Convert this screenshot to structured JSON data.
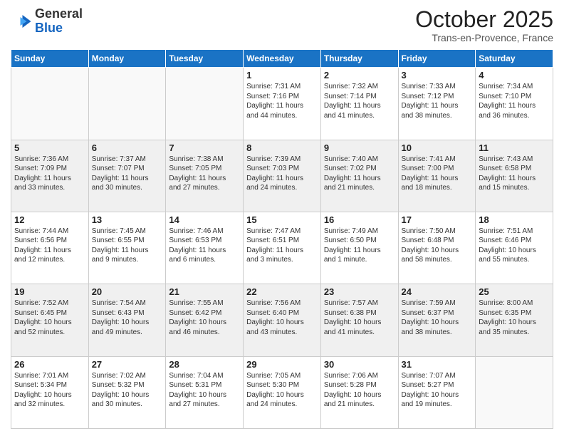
{
  "header": {
    "logo_line1": "General",
    "logo_line2": "Blue",
    "title": "October 2025",
    "subtitle": "Trans-en-Provence, France"
  },
  "days_of_week": [
    "Sunday",
    "Monday",
    "Tuesday",
    "Wednesday",
    "Thursday",
    "Friday",
    "Saturday"
  ],
  "weeks": [
    [
      {
        "day": "",
        "text": ""
      },
      {
        "day": "",
        "text": ""
      },
      {
        "day": "",
        "text": ""
      },
      {
        "day": "1",
        "text": "Sunrise: 7:31 AM\nSunset: 7:16 PM\nDaylight: 11 hours\nand 44 minutes."
      },
      {
        "day": "2",
        "text": "Sunrise: 7:32 AM\nSunset: 7:14 PM\nDaylight: 11 hours\nand 41 minutes."
      },
      {
        "day": "3",
        "text": "Sunrise: 7:33 AM\nSunset: 7:12 PM\nDaylight: 11 hours\nand 38 minutes."
      },
      {
        "day": "4",
        "text": "Sunrise: 7:34 AM\nSunset: 7:10 PM\nDaylight: 11 hours\nand 36 minutes."
      }
    ],
    [
      {
        "day": "5",
        "text": "Sunrise: 7:36 AM\nSunset: 7:09 PM\nDaylight: 11 hours\nand 33 minutes."
      },
      {
        "day": "6",
        "text": "Sunrise: 7:37 AM\nSunset: 7:07 PM\nDaylight: 11 hours\nand 30 minutes."
      },
      {
        "day": "7",
        "text": "Sunrise: 7:38 AM\nSunset: 7:05 PM\nDaylight: 11 hours\nand 27 minutes."
      },
      {
        "day": "8",
        "text": "Sunrise: 7:39 AM\nSunset: 7:03 PM\nDaylight: 11 hours\nand 24 minutes."
      },
      {
        "day": "9",
        "text": "Sunrise: 7:40 AM\nSunset: 7:02 PM\nDaylight: 11 hours\nand 21 minutes."
      },
      {
        "day": "10",
        "text": "Sunrise: 7:41 AM\nSunset: 7:00 PM\nDaylight: 11 hours\nand 18 minutes."
      },
      {
        "day": "11",
        "text": "Sunrise: 7:43 AM\nSunset: 6:58 PM\nDaylight: 11 hours\nand 15 minutes."
      }
    ],
    [
      {
        "day": "12",
        "text": "Sunrise: 7:44 AM\nSunset: 6:56 PM\nDaylight: 11 hours\nand 12 minutes."
      },
      {
        "day": "13",
        "text": "Sunrise: 7:45 AM\nSunset: 6:55 PM\nDaylight: 11 hours\nand 9 minutes."
      },
      {
        "day": "14",
        "text": "Sunrise: 7:46 AM\nSunset: 6:53 PM\nDaylight: 11 hours\nand 6 minutes."
      },
      {
        "day": "15",
        "text": "Sunrise: 7:47 AM\nSunset: 6:51 PM\nDaylight: 11 hours\nand 3 minutes."
      },
      {
        "day": "16",
        "text": "Sunrise: 7:49 AM\nSunset: 6:50 PM\nDaylight: 11 hours\nand 1 minute."
      },
      {
        "day": "17",
        "text": "Sunrise: 7:50 AM\nSunset: 6:48 PM\nDaylight: 10 hours\nand 58 minutes."
      },
      {
        "day": "18",
        "text": "Sunrise: 7:51 AM\nSunset: 6:46 PM\nDaylight: 10 hours\nand 55 minutes."
      }
    ],
    [
      {
        "day": "19",
        "text": "Sunrise: 7:52 AM\nSunset: 6:45 PM\nDaylight: 10 hours\nand 52 minutes."
      },
      {
        "day": "20",
        "text": "Sunrise: 7:54 AM\nSunset: 6:43 PM\nDaylight: 10 hours\nand 49 minutes."
      },
      {
        "day": "21",
        "text": "Sunrise: 7:55 AM\nSunset: 6:42 PM\nDaylight: 10 hours\nand 46 minutes."
      },
      {
        "day": "22",
        "text": "Sunrise: 7:56 AM\nSunset: 6:40 PM\nDaylight: 10 hours\nand 43 minutes."
      },
      {
        "day": "23",
        "text": "Sunrise: 7:57 AM\nSunset: 6:38 PM\nDaylight: 10 hours\nand 41 minutes."
      },
      {
        "day": "24",
        "text": "Sunrise: 7:59 AM\nSunset: 6:37 PM\nDaylight: 10 hours\nand 38 minutes."
      },
      {
        "day": "25",
        "text": "Sunrise: 8:00 AM\nSunset: 6:35 PM\nDaylight: 10 hours\nand 35 minutes."
      }
    ],
    [
      {
        "day": "26",
        "text": "Sunrise: 7:01 AM\nSunset: 5:34 PM\nDaylight: 10 hours\nand 32 minutes."
      },
      {
        "day": "27",
        "text": "Sunrise: 7:02 AM\nSunset: 5:32 PM\nDaylight: 10 hours\nand 30 minutes."
      },
      {
        "day": "28",
        "text": "Sunrise: 7:04 AM\nSunset: 5:31 PM\nDaylight: 10 hours\nand 27 minutes."
      },
      {
        "day": "29",
        "text": "Sunrise: 7:05 AM\nSunset: 5:30 PM\nDaylight: 10 hours\nand 24 minutes."
      },
      {
        "day": "30",
        "text": "Sunrise: 7:06 AM\nSunset: 5:28 PM\nDaylight: 10 hours\nand 21 minutes."
      },
      {
        "day": "31",
        "text": "Sunrise: 7:07 AM\nSunset: 5:27 PM\nDaylight: 10 hours\nand 19 minutes."
      },
      {
        "day": "",
        "text": ""
      }
    ]
  ]
}
